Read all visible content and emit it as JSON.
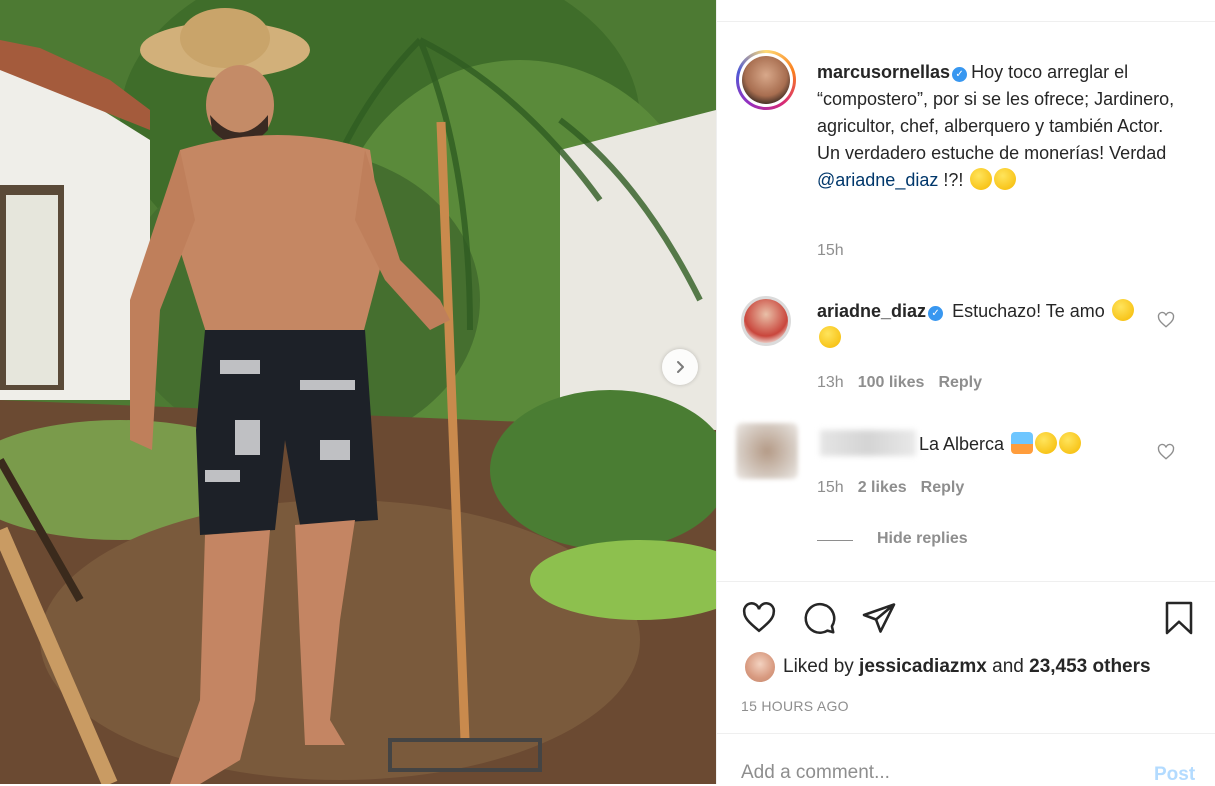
{
  "post": {
    "author": "marcusornellas",
    "caption_parts": [
      "Hoy toco arreglar el “compostero”, por si se les ofrece; Jardinero, agricultor, chef, alberquero y también Actor. Un verdadero estuche de monerías! Verdad ",
      "@ariadne_diaz",
      " !?! "
    ],
    "caption_time": "15h"
  },
  "comments": [
    {
      "author": "ariadne_diaz",
      "text": "Estuchazo! Te amo",
      "time": "13h",
      "likes": "100 likes",
      "reply": "Reply"
    },
    {
      "author": "",
      "text": "La Alberca",
      "time": "15h",
      "likes": "2 likes",
      "reply": "Reply"
    }
  ],
  "hide_replies": "Hide replies",
  "likes": {
    "prefix": "Liked by ",
    "user": "jessicadiazmx",
    "middle": " and ",
    "count": "23,453 others"
  },
  "timestamp": "15 HOURS AGO",
  "add_comment": {
    "placeholder": "Add a comment...",
    "post_label": "Post"
  },
  "icons": {
    "like": "heart-icon",
    "comment": "comment-icon",
    "share": "paper-plane-icon",
    "save": "bookmark-icon",
    "next": "chevron-right-icon",
    "verified": "verified-badge-icon"
  },
  "colors": {
    "verified": "#3897f0",
    "link": "#00376b",
    "muted": "#8e8e8e",
    "post_disabled": "#b3dbff"
  }
}
